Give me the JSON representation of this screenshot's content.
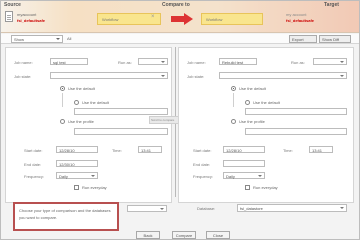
{
  "header": {
    "left_label": "Source",
    "center_label": "Compare to",
    "right_label": "Target",
    "source_line1": "myaccount",
    "source_line2": "fsl_defaultsafe",
    "box1_text": "Workflow",
    "box2_text": "Workflow",
    "target_line1": "my account",
    "target_line2": "fsl_defaultsafe"
  },
  "toolbar": {
    "select_value": "Show",
    "check_label": "All",
    "btn1_label": "Export",
    "btn2_label": "Show Diff"
  },
  "left_panel": {
    "field1_label": "Job name:",
    "field1_value": "sql test",
    "field1b_label": "Run as:",
    "field2_label": "Job state:",
    "option1": "Use the default",
    "option1_sub": "Use the default",
    "option2": "Use the profile",
    "date_label": "Start date:",
    "date_value": "12/28/10",
    "time_label": "Time:",
    "time_value": "13:41",
    "end_label": "End date:",
    "end_value": "12/30/10",
    "freq_label": "Frequency:",
    "freq_value": "Daily",
    "repeat_label": "Run everyday"
  },
  "right_panel": {
    "field1_label": "Job name:",
    "field1_value": "Rebuild test",
    "field1b_label": "Run as:",
    "field2_label": "Job state:",
    "option1": "Use the default",
    "option1_sub": "Use the default",
    "option2": "Use the profile",
    "date_label": "Start date:",
    "date_value": "12/28/10",
    "time_label": "Time:",
    "time_value": "13:41",
    "end_label": "End date:",
    "end_value": "",
    "freq_label": "Frequency:",
    "freq_value": "Daily",
    "repeat_label": "Run everyday"
  },
  "hint": "Scroll to compare",
  "note": {
    "text": "Choose your type of comparison and the databases you want to compare."
  },
  "bottom": {
    "left_dropdown": "",
    "right_label": "Database:",
    "right_dropdown": "fsl_datastore"
  },
  "footer": {
    "btn1": "Back",
    "btn2": "Compare",
    "btn3": "Close"
  }
}
